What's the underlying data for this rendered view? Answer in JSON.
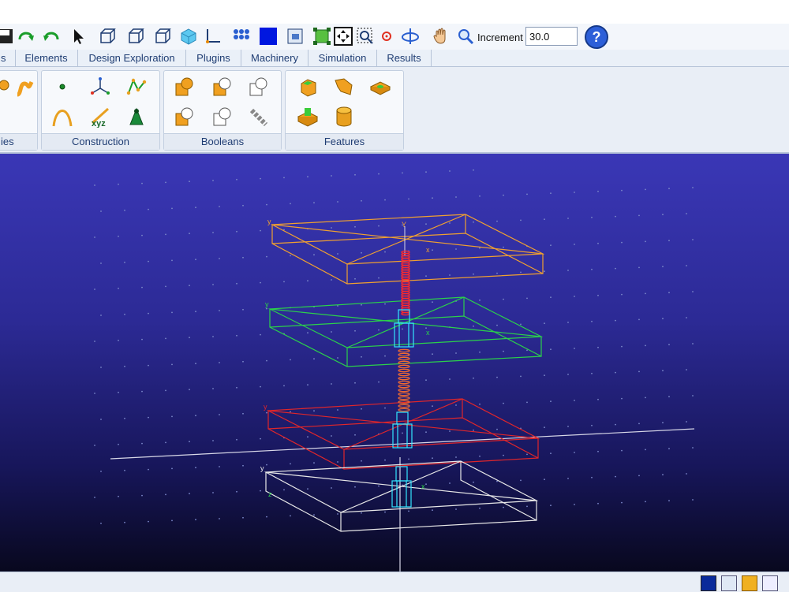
{
  "toolbar": {
    "increment_label": "Increment",
    "increment_value": "30.0",
    "icons": [
      "save-icon",
      "redo-icon",
      "undo-icon",
      "select-arrow-icon",
      "view-front-icon",
      "view-side-icon",
      "view-iso-icon",
      "view-shaded-icon",
      "axes-icon",
      "grid-snap-icon",
      "color-square-icon",
      "zoom-window-icon",
      "fit-all-icon",
      "move-icon",
      "zoom-box-icon",
      "target-icon",
      "rotate-icon",
      "pan-hand-icon",
      "zoom-icon",
      "help-icon"
    ]
  },
  "tabs": [
    "s",
    "Elements",
    "Design Exploration",
    "Plugins",
    "Machinery",
    "Simulation",
    "Results"
  ],
  "ribbon": {
    "groups": [
      {
        "label": "ies"
      },
      {
        "label": "Construction"
      },
      {
        "label": "Booleans"
      },
      {
        "label": "Features"
      }
    ]
  },
  "viewport": {
    "background_top": "#3a37b6",
    "background_bottom": "#08081e",
    "axis_labels": [
      "y",
      "y",
      "y",
      "y",
      "x",
      "x",
      "x",
      "z",
      "Y"
    ]
  },
  "colors": {
    "orange_frame": "#f0a030",
    "green_frame": "#2bd14a",
    "red_frame": "#e0262a",
    "white_frame": "#e8e8e8",
    "cyan_joint": "#33e6ff"
  }
}
